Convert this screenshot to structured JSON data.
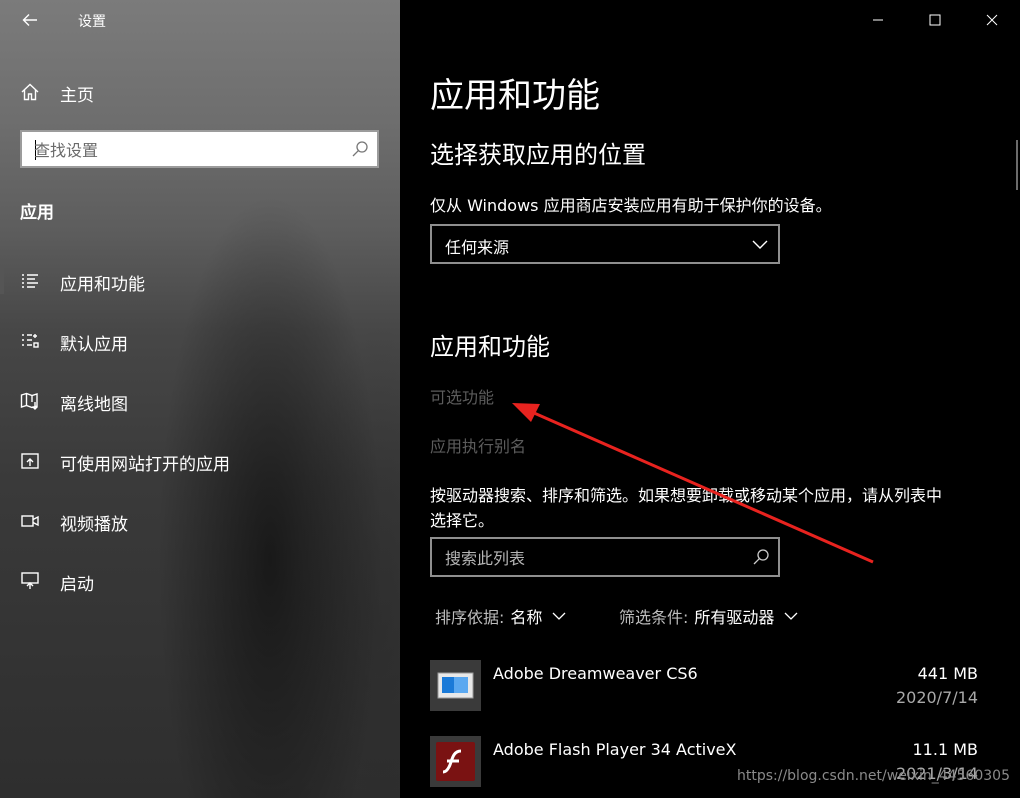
{
  "window": {
    "title": "设置",
    "controls": {
      "minimize": "minimize",
      "maximize": "maximize",
      "close": "close"
    }
  },
  "sidebar": {
    "home": "主页",
    "search_placeholder": "查找设置",
    "section": "应用",
    "items": [
      {
        "label": "应用和功能",
        "icon": "list-icon",
        "selected": true
      },
      {
        "label": "默认应用",
        "icon": "default-apps-icon",
        "selected": false
      },
      {
        "label": "离线地图",
        "icon": "map-icon",
        "selected": false
      },
      {
        "label": "可使用网站打开的应用",
        "icon": "open-in-web-icon",
        "selected": false
      },
      {
        "label": "视频播放",
        "icon": "video-icon",
        "selected": false
      },
      {
        "label": "启动",
        "icon": "startup-icon",
        "selected": false
      }
    ]
  },
  "main": {
    "title": "应用和功能",
    "install_section": {
      "heading": "选择获取应用的位置",
      "description": "仅从 Windows 应用商店安装应用有助于保护你的设备。",
      "dropdown_value": "任何来源"
    },
    "apps_section": {
      "heading": "应用和功能",
      "link_optional": "可选功能",
      "link_alias": "应用执行别名",
      "description_line1": "按驱动器搜索、排序和筛选。如果想要卸载或移动某个应用，请从列表中",
      "description_line2": "选择它。",
      "search_placeholder": "搜索此列表",
      "sort_label": "排序依据:",
      "sort_value": "名称",
      "filter_label": "筛选条件:",
      "filter_value": "所有驱动器"
    },
    "apps": [
      {
        "name": "Adobe Dreamweaver CS6",
        "size": "441 MB",
        "date": "2020/7/14",
        "icon": "dreamweaver-icon"
      },
      {
        "name": "Adobe Flash Player 34 ActiveX",
        "size": "11.1 MB",
        "date": "2021/3/14",
        "icon": "flash-icon"
      }
    ]
  },
  "watermark": "https://blog.csdn.net/weixin_44560305",
  "colors": {
    "annotation_arrow": "#e8231f",
    "disabled_link": "#5c5c5c"
  }
}
